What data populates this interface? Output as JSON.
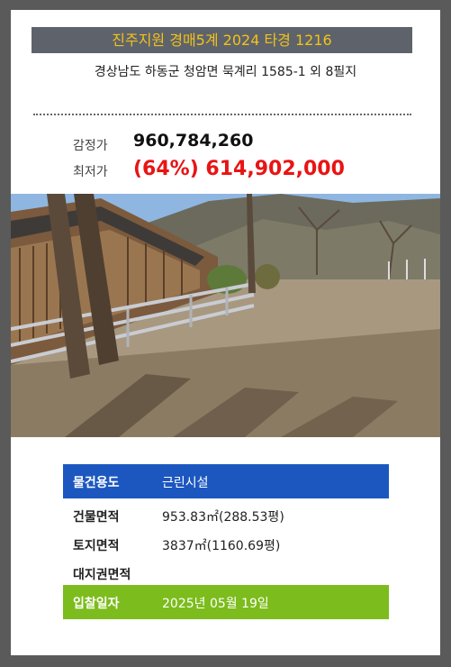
{
  "header": {
    "title": "진주지원 경매5계 2024 타경 1216",
    "address": "경상남도 하동군 청암면 묵계리 1585-1 외 8필지"
  },
  "prices": {
    "appraised_label": "감정가",
    "appraised_value": "960,784,260",
    "minimum_label": "최저가",
    "minimum_value": "(64%) 614,902,000"
  },
  "details": {
    "usage_label": "물건용도",
    "usage_value": "근린시설",
    "building_area_label": "건물면적",
    "building_area_value": "953.83㎡(288.53평)",
    "land_area_label": "토지면적",
    "land_area_value": "3837㎡(1160.69평)",
    "land_right_label": "대지권면적",
    "land_right_value": "",
    "bid_date_label": "입찰일자",
    "bid_date_value": "2025년 05월 19일"
  },
  "colors": {
    "title_bg": "#5e636b",
    "title_text": "#f2c21a",
    "minimum_price": "#e81414",
    "usage_row": "#1c57c0",
    "bid_row": "#7cbc1c"
  }
}
